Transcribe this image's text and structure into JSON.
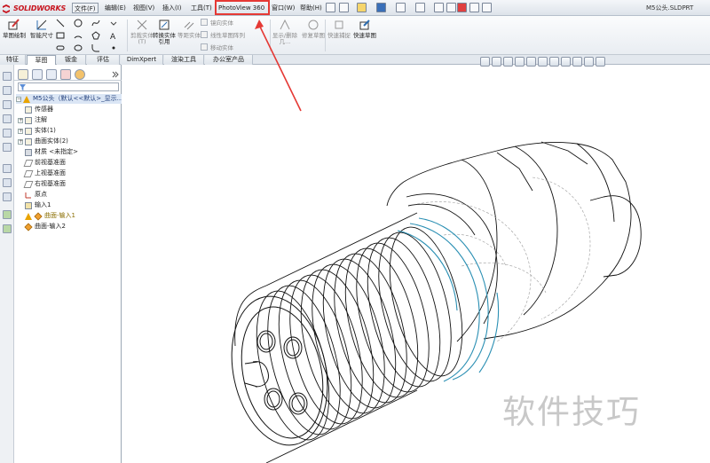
{
  "app": {
    "brand": "SOLIDWORKS",
    "document_title": "M5公头.SLDPRT"
  },
  "menubar": {
    "items": [
      {
        "label": "文件(F)"
      },
      {
        "label": "编辑(E)"
      },
      {
        "label": "视图(V)"
      },
      {
        "label": "插入(I)"
      },
      {
        "label": "工具(T)"
      },
      {
        "label": "PhotoView 360"
      },
      {
        "label": "窗口(W)"
      },
      {
        "label": "帮助(H)"
      }
    ],
    "highlight_color": "#e53935"
  },
  "commands": {
    "sketch": "草图绘制",
    "smart_dim": "智能尺寸",
    "trim": "剪裁实体(T)",
    "convert": "转换实体引用",
    "offset": "等距实体",
    "mirror": "镜向实体",
    "linear_pattern": "线性草图阵列",
    "move": "移动实体",
    "display_delete": "显示/删除几...",
    "repair": "修复草图",
    "quick_snap": "快速捕捉",
    "rapid_sketch": "快速草图"
  },
  "tabs": [
    {
      "label": "特征"
    },
    {
      "label": "草图"
    },
    {
      "label": "钣金"
    },
    {
      "label": "评估"
    },
    {
      "label": "DimXpert"
    },
    {
      "label": "渲染工具"
    },
    {
      "label": "办公室产品"
    }
  ],
  "tree": {
    "root": "M5公头（默认<<默认>_显示...",
    "items": [
      {
        "label": "传感器"
      },
      {
        "label": "注解"
      },
      {
        "label": "实体(1)"
      },
      {
        "label": "曲面实体(2)"
      },
      {
        "label": "材质 <未指定>"
      },
      {
        "label": "前视基准面"
      },
      {
        "label": "上视基准面"
      },
      {
        "label": "右视基准面"
      },
      {
        "label": "原点"
      },
      {
        "label": "输入1"
      },
      {
        "label": "曲面-输入1"
      },
      {
        "label": "曲面-输入2"
      }
    ]
  },
  "watermark": "软件技巧",
  "colors": {
    "thread_highlight": "#2a8fb3",
    "edges": "#111111",
    "hidden_edges": "#9a9a9a"
  }
}
